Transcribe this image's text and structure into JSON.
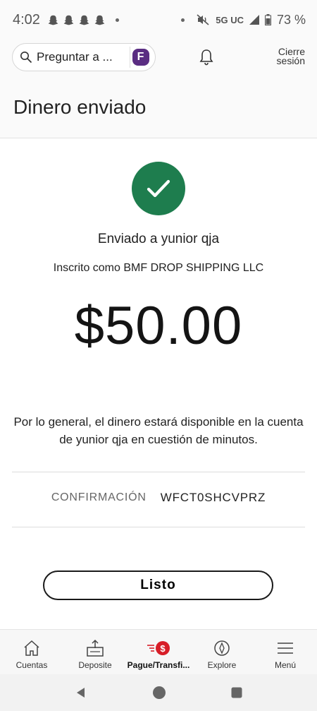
{
  "status_bar": {
    "time": "4:02",
    "network": "5G UC",
    "battery": "73 %",
    "icons": [
      "snapchat-icon",
      "snapchat-icon",
      "snapchat-icon",
      "snapchat-icon",
      "dot-icon",
      "mute-icon",
      "signal-icon",
      "battery-icon"
    ]
  },
  "header": {
    "search_text": "Preguntar a ...",
    "assistant_badge": "F",
    "signout_label_line1": "Cierre",
    "signout_label_line2": "sesión"
  },
  "page": {
    "title": "Dinero enviado"
  },
  "confirmation": {
    "sent_to": "Enviado a yunior qja",
    "enrolled_as": "Inscrito como BMF DROP SHIPPING LLC",
    "amount": "$50.00",
    "availability_note": "Por lo general, el dinero estará disponible en la cuenta de yunior qja en cuestión de minutos.",
    "confirmation_label": "CONFIRMACIÓN",
    "confirmation_number": "WFCT0SHCVPRZ",
    "done_label": "Listo"
  },
  "bottom_nav": {
    "items": [
      {
        "label": "Cuentas",
        "icon": "house-icon"
      },
      {
        "label": "Deposite",
        "icon": "deposit-icon"
      },
      {
        "label": "Pague/Transfi...",
        "icon": "pay-transfer-icon",
        "badge": "$"
      },
      {
        "label": "Explore",
        "icon": "compass-icon"
      },
      {
        "label": "Menú",
        "icon": "menu-icon"
      }
    ]
  },
  "colors": {
    "success_green": "#1e7d4e",
    "brand_red": "#d71e28",
    "assistant_purple": "#5a2d82"
  }
}
